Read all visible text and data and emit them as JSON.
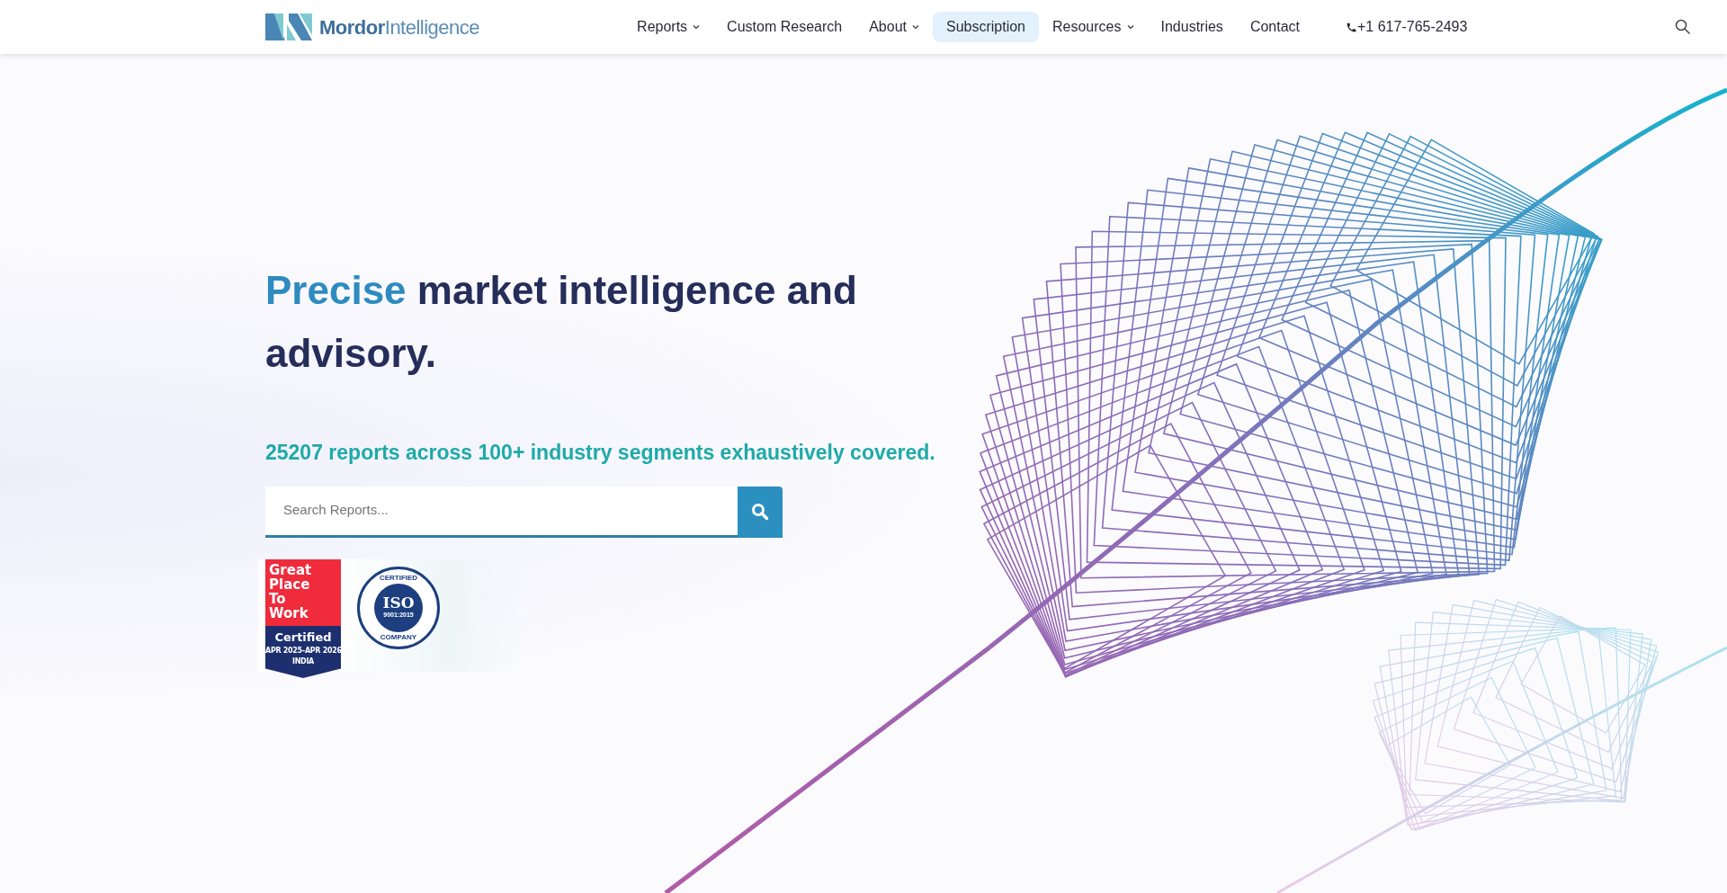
{
  "brand": {
    "name_bold": "Mordor",
    "name_light": "Intelligence"
  },
  "nav": [
    {
      "label": "Reports",
      "dropdown": true,
      "selected": false
    },
    {
      "label": "Custom Research",
      "dropdown": false,
      "selected": false
    },
    {
      "label": "About",
      "dropdown": true,
      "selected": false
    },
    {
      "label": "Subscription",
      "dropdown": false,
      "selected": true
    },
    {
      "label": "Resources",
      "dropdown": true,
      "selected": false
    },
    {
      "label": "Industries",
      "dropdown": false,
      "selected": false
    },
    {
      "label": "Contact",
      "dropdown": false,
      "selected": false
    }
  ],
  "phone": "+1 617-765-2493",
  "hero": {
    "headline_accent": "Precise",
    "headline_rest": "market intelligence and advisory.",
    "subline": "25207 reports across 100+ industry segments exhaustively covered.",
    "search": {
      "placeholder": "Search Reports..."
    }
  },
  "badges": {
    "gptw": {
      "lines": [
        "Great",
        "Place",
        "To",
        "Work"
      ],
      "certified": "Certified",
      "period": "APR 2025-APR 2026",
      "country": "INDIA"
    },
    "iso": {
      "top": "CERTIFIED",
      "title": "ISO",
      "standard": "9001:2015",
      "bottom": "COMPANY"
    }
  }
}
